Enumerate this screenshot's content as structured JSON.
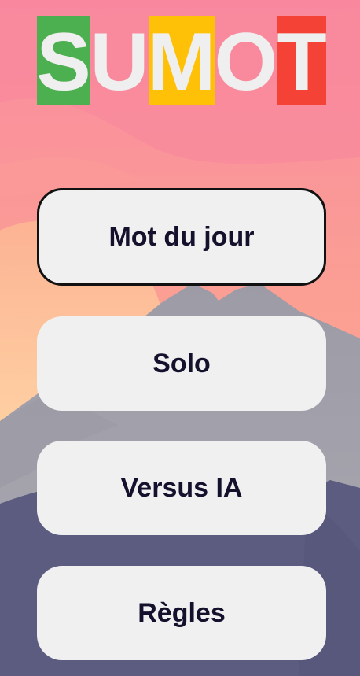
{
  "logo": {
    "letters": [
      {
        "char": "S",
        "bg": "#4caf50"
      },
      {
        "char": "U",
        "bg": "transparent"
      },
      {
        "char": "M",
        "bg": "#ffc107"
      },
      {
        "char": "O",
        "bg": "transparent"
      },
      {
        "char": "T",
        "bg": "#f44336"
      }
    ]
  },
  "menu": {
    "daily_word": "Mot du jour",
    "solo": "Solo",
    "versus_ai": "Versus IA",
    "rules": "Règles"
  },
  "colors": {
    "sky_top": "#f98ba0",
    "sun": "#ffc89e",
    "mountain": "#a8a6ad",
    "ground": "#5b5a80",
    "button_bg": "#f0f0f0",
    "button_text": "#14112d",
    "letter_color": "#efefef"
  }
}
